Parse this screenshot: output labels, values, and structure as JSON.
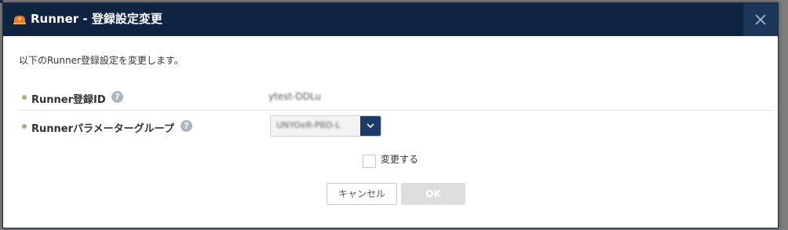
{
  "dialog": {
    "title": "Runner - 登録設定変更",
    "description": "以下のRunner登録設定を変更します。",
    "close_icon": "close-icon"
  },
  "fields": {
    "runner_id": {
      "label": "Runner登録ID",
      "value": "ytest-DDLu"
    },
    "parameter_group": {
      "label": "Runnerパラメーターグループ",
      "selected": "UNYOeR-PBD-L"
    }
  },
  "change_checkbox": {
    "label": "変更する",
    "checked": false
  },
  "buttons": {
    "cancel_label": "キャンセル",
    "ok_label": "OK",
    "ok_enabled": false
  },
  "colors": {
    "header_bg": "#0f2442",
    "accent": "#1c3c68",
    "bullet": "#b4a978",
    "logo": "#f07a2a"
  },
  "icons": {
    "logo": "runner-logo-icon",
    "help": "help-icon",
    "dropdown": "chevron-down-icon"
  }
}
